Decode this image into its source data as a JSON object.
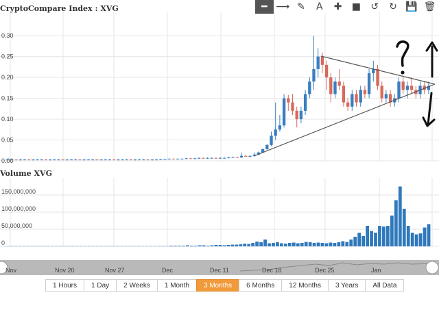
{
  "toolbar": {
    "items": [
      {
        "name": "line-tool-icon",
        "glyph": "━",
        "active": true
      },
      {
        "name": "arrow-tool-icon",
        "glyph": "⟶",
        "active": false
      },
      {
        "name": "pencil-tool-icon",
        "glyph": "✎",
        "active": false
      },
      {
        "name": "text-tool-icon",
        "glyph": "A",
        "active": false
      },
      {
        "name": "crosshair-tool-icon",
        "glyph": "✚",
        "active": false
      },
      {
        "name": "rectangle-tool-icon",
        "glyph": "■",
        "active": false
      },
      {
        "name": "undo-icon",
        "glyph": "↺",
        "active": false
      },
      {
        "name": "redo-icon",
        "glyph": "↻",
        "active": false
      },
      {
        "name": "save-icon",
        "glyph": "💾",
        "active": false
      },
      {
        "name": "delete-icon",
        "glyph": "🗑",
        "active": false
      }
    ]
  },
  "range_buttons": [
    "1 Hours",
    "1 Day",
    "2 Weeks",
    "1 Month",
    "3 Months",
    "6 Months",
    "12 Months",
    "3 Years",
    "All Data"
  ],
  "active_range": "3 Months",
  "navigator": {
    "labels": [
      "Nov",
      "Nov 20",
      "Nov 27",
      "Dec",
      "Dec 11",
      "Dec 18",
      "Dec 25",
      "Jan"
    ]
  },
  "colors": {
    "up": "#3a7ebf",
    "down": "#d9695a",
    "volume": "#2f78bb",
    "annotation": "#111111",
    "range_active": "#f09a3a"
  },
  "chart_data": [
    {
      "type": "candlestick",
      "title": "CryptoCompare Index : XVG",
      "yticks": [
        "0.30",
        "0.25",
        "0.20",
        "0.15",
        "0.10",
        "0.05",
        "0.00"
      ],
      "ylim": [
        0,
        0.32
      ],
      "xticks": [
        "Nov 20",
        "Nov 27",
        "Dec",
        "Dec 11",
        "Dec 18",
        "Dec 25",
        "Jan"
      ],
      "grid": true,
      "candles": [
        [
          0.002,
          0.004,
          0.001,
          0.003
        ],
        [
          0.003,
          0.004,
          0.002,
          0.003
        ],
        [
          0.003,
          0.004,
          0.002,
          0.002
        ],
        [
          0.002,
          0.004,
          0.001,
          0.003
        ],
        [
          0.003,
          0.004,
          0.002,
          0.003
        ],
        [
          0.003,
          0.004,
          0.002,
          0.002
        ],
        [
          0.002,
          0.004,
          0.001,
          0.003
        ],
        [
          0.003,
          0.004,
          0.002,
          0.003
        ],
        [
          0.003,
          0.004,
          0.002,
          0.003
        ],
        [
          0.003,
          0.004,
          0.002,
          0.002
        ],
        [
          0.002,
          0.004,
          0.001,
          0.003
        ],
        [
          0.003,
          0.004,
          0.002,
          0.003
        ],
        [
          0.003,
          0.004,
          0.002,
          0.003
        ],
        [
          0.003,
          0.004,
          0.002,
          0.002
        ],
        [
          0.002,
          0.004,
          0.001,
          0.003
        ],
        [
          0.003,
          0.004,
          0.002,
          0.003
        ],
        [
          0.003,
          0.004,
          0.002,
          0.003
        ],
        [
          0.003,
          0.004,
          0.002,
          0.002
        ],
        [
          0.002,
          0.004,
          0.001,
          0.003
        ],
        [
          0.003,
          0.004,
          0.002,
          0.003
        ],
        [
          0.003,
          0.004,
          0.002,
          0.003
        ],
        [
          0.003,
          0.004,
          0.002,
          0.002
        ],
        [
          0.002,
          0.004,
          0.001,
          0.003
        ],
        [
          0.003,
          0.004,
          0.002,
          0.003
        ],
        [
          0.003,
          0.004,
          0.002,
          0.003
        ],
        [
          0.003,
          0.004,
          0.002,
          0.002
        ],
        [
          0.002,
          0.004,
          0.001,
          0.003
        ],
        [
          0.003,
          0.004,
          0.002,
          0.003
        ],
        [
          0.003,
          0.004,
          0.002,
          0.003
        ],
        [
          0.003,
          0.004,
          0.002,
          0.002
        ],
        [
          0.002,
          0.004,
          0.001,
          0.003
        ],
        [
          0.003,
          0.004,
          0.002,
          0.003
        ],
        [
          0.003,
          0.004,
          0.002,
          0.003
        ],
        [
          0.003,
          0.004,
          0.002,
          0.002
        ],
        [
          0.002,
          0.004,
          0.001,
          0.003
        ],
        [
          0.003,
          0.004,
          0.002,
          0.003
        ],
        [
          0.003,
          0.005,
          0.002,
          0.004
        ],
        [
          0.004,
          0.005,
          0.003,
          0.004
        ],
        [
          0.004,
          0.006,
          0.003,
          0.005
        ],
        [
          0.005,
          0.006,
          0.004,
          0.004
        ],
        [
          0.004,
          0.006,
          0.003,
          0.005
        ],
        [
          0.005,
          0.006,
          0.004,
          0.005
        ],
        [
          0.005,
          0.007,
          0.004,
          0.006
        ],
        [
          0.006,
          0.007,
          0.005,
          0.005
        ],
        [
          0.005,
          0.007,
          0.004,
          0.006
        ],
        [
          0.006,
          0.008,
          0.005,
          0.007
        ],
        [
          0.007,
          0.008,
          0.006,
          0.006
        ],
        [
          0.006,
          0.008,
          0.005,
          0.007
        ],
        [
          0.007,
          0.008,
          0.006,
          0.007
        ],
        [
          0.007,
          0.008,
          0.006,
          0.006
        ],
        [
          0.006,
          0.008,
          0.005,
          0.007
        ],
        [
          0.007,
          0.008,
          0.006,
          0.007
        ],
        [
          0.007,
          0.009,
          0.006,
          0.008
        ],
        [
          0.008,
          0.01,
          0.007,
          0.009
        ],
        [
          0.009,
          0.01,
          0.008,
          0.008
        ],
        [
          0.008,
          0.02,
          0.007,
          0.012
        ],
        [
          0.012,
          0.014,
          0.009,
          0.01
        ],
        [
          0.01,
          0.013,
          0.008,
          0.012
        ],
        [
          0.012,
          0.02,
          0.01,
          0.015
        ],
        [
          0.015,
          0.022,
          0.013,
          0.02
        ],
        [
          0.02,
          0.03,
          0.018,
          0.028
        ],
        [
          0.028,
          0.04,
          0.026,
          0.038
        ],
        [
          0.038,
          0.07,
          0.035,
          0.06
        ],
        [
          0.06,
          0.14,
          0.05,
          0.075
        ],
        [
          0.075,
          0.11,
          0.07,
          0.085
        ],
        [
          0.085,
          0.16,
          0.08,
          0.15
        ],
        [
          0.15,
          0.158,
          0.12,
          0.14
        ],
        [
          0.14,
          0.16,
          0.11,
          0.12
        ],
        [
          0.12,
          0.13,
          0.08,
          0.1
        ],
        [
          0.1,
          0.13,
          0.09,
          0.12
        ],
        [
          0.12,
          0.17,
          0.11,
          0.16
        ],
        [
          0.16,
          0.2,
          0.15,
          0.19
        ],
        [
          0.19,
          0.3,
          0.17,
          0.22
        ],
        [
          0.22,
          0.27,
          0.2,
          0.25
        ],
        [
          0.25,
          0.26,
          0.21,
          0.23
        ],
        [
          0.23,
          0.24,
          0.17,
          0.2
        ],
        [
          0.2,
          0.21,
          0.14,
          0.16
        ],
        [
          0.16,
          0.2,
          0.15,
          0.19
        ],
        [
          0.19,
          0.22,
          0.17,
          0.18
        ],
        [
          0.18,
          0.19,
          0.13,
          0.14
        ],
        [
          0.14,
          0.15,
          0.12,
          0.13
        ],
        [
          0.13,
          0.17,
          0.12,
          0.16
        ],
        [
          0.16,
          0.17,
          0.13,
          0.14
        ],
        [
          0.14,
          0.18,
          0.13,
          0.17
        ],
        [
          0.17,
          0.18,
          0.15,
          0.16
        ],
        [
          0.16,
          0.22,
          0.15,
          0.21
        ],
        [
          0.21,
          0.24,
          0.19,
          0.22
        ],
        [
          0.22,
          0.23,
          0.17,
          0.18
        ],
        [
          0.18,
          0.19,
          0.14,
          0.15
        ],
        [
          0.15,
          0.17,
          0.14,
          0.16
        ],
        [
          0.16,
          0.17,
          0.13,
          0.14
        ],
        [
          0.14,
          0.16,
          0.13,
          0.15
        ],
        [
          0.15,
          0.2,
          0.14,
          0.19
        ],
        [
          0.19,
          0.2,
          0.16,
          0.17
        ],
        [
          0.17,
          0.19,
          0.15,
          0.18
        ],
        [
          0.18,
          0.2,
          0.16,
          0.17
        ],
        [
          0.17,
          0.18,
          0.15,
          0.16
        ],
        [
          0.16,
          0.19,
          0.15,
          0.18
        ],
        [
          0.18,
          0.19,
          0.16,
          0.17
        ],
        [
          0.17,
          0.19,
          0.16,
          0.18
        ]
      ]
    },
    {
      "type": "bar",
      "title": "Volume XVG",
      "yticks": [
        "150,000,000",
        "100,000,000",
        "50,000,000",
        "0"
      ],
      "ylim": [
        0,
        200000000
      ],
      "values": [
        1000000,
        1000000,
        1000000,
        1000000,
        1000000,
        1000000,
        1000000,
        1000000,
        1000000,
        1000000,
        1000000,
        1000000,
        1000000,
        1000000,
        1000000,
        1000000,
        1000000,
        1000000,
        1000000,
        1000000,
        1000000,
        1000000,
        1000000,
        1000000,
        1000000,
        1000000,
        1000000,
        1000000,
        1000000,
        1000000,
        1000000,
        1000000,
        1000000,
        1000000,
        1000000,
        1000000,
        1000000,
        1000000,
        1000000,
        1000000,
        2000000,
        2000000,
        2000000,
        2000000,
        3000000,
        2000000,
        2000000,
        3000000,
        3000000,
        2000000,
        3000000,
        4000000,
        4000000,
        3000000,
        4000000,
        5000000,
        5000000,
        6000000,
        8000000,
        7000000,
        10000000,
        14000000,
        12000000,
        20000000,
        9000000,
        10000000,
        12000000,
        9000000,
        8000000,
        10000000,
        11000000,
        9000000,
        10000000,
        13000000,
        12000000,
        10000000,
        11000000,
        10000000,
        9000000,
        11000000,
        10000000,
        12000000,
        15000000,
        13000000,
        20000000,
        28000000,
        40000000,
        30000000,
        60000000,
        45000000,
        40000000,
        60000000,
        58000000,
        60000000,
        90000000,
        135000000,
        175000000,
        110000000,
        60000000,
        40000000,
        35000000,
        38000000,
        55000000,
        65000000
      ]
    }
  ]
}
